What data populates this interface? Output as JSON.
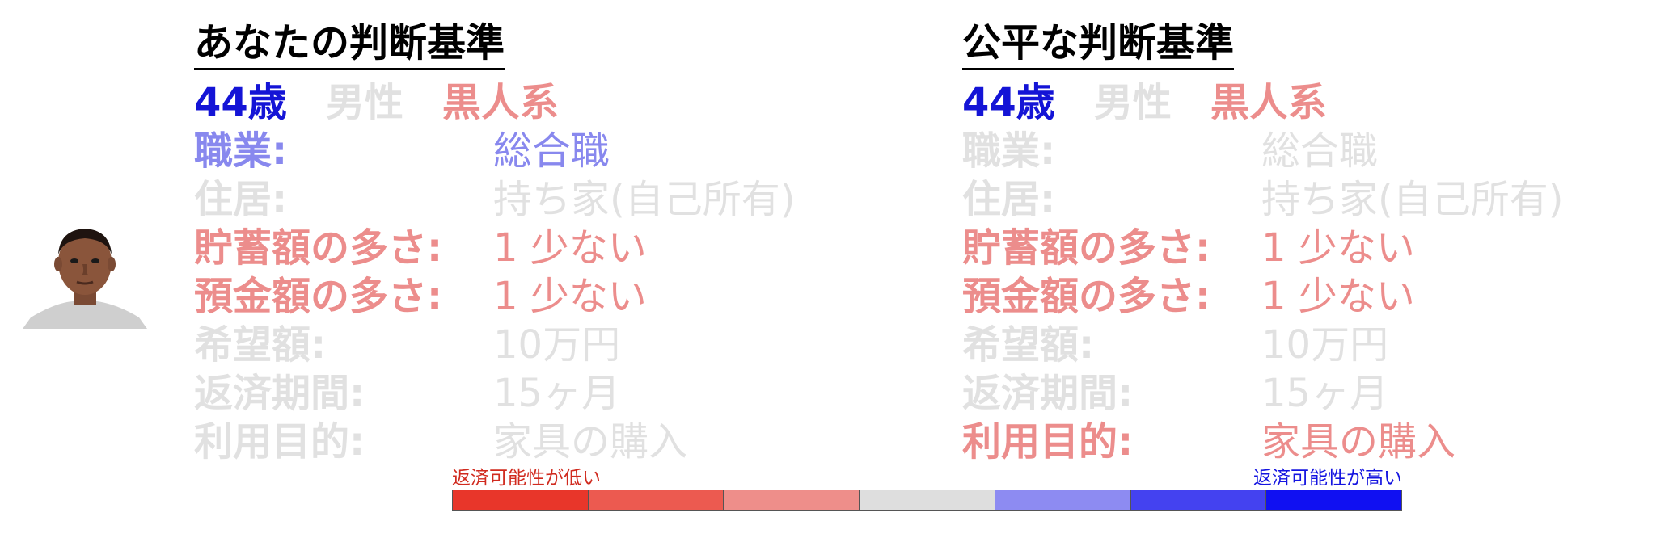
{
  "colors": {
    "blue_dark": "#1414d6",
    "blue_light": "#8888ee",
    "red_light": "#ec8d8c",
    "gray_light": "#e1e1e1",
    "black": "#000000"
  },
  "left_panel": {
    "title": "あなたの判断基準",
    "age": "44歳",
    "age_color": "#1414d6",
    "gender": "男性",
    "gender_color": "#e1e1e1",
    "race": "黒人系",
    "race_color": "#ec8d8c",
    "attributes": [
      {
        "label": "職業:",
        "value": "総合職",
        "color": "#8888ee"
      },
      {
        "label": "住居:",
        "value": "持ち家(自己所有)",
        "color": "#e1e1e1"
      },
      {
        "label": "貯蓄額の多さ:",
        "value": "1 少ない",
        "color": "#ec8d8c"
      },
      {
        "label": "預金額の多さ:",
        "value": "1 少ない",
        "color": "#ec8d8c"
      },
      {
        "label": "希望額:",
        "value": "10万円",
        "color": "#e1e1e1"
      },
      {
        "label": "返済期間:",
        "value": "15ヶ月",
        "color": "#e1e1e1"
      },
      {
        "label": "利用目的:",
        "value": "家具の購入",
        "color": "#e1e1e1"
      }
    ]
  },
  "right_panel": {
    "title": "公平な判断基準",
    "age": "44歳",
    "age_color": "#1414d6",
    "gender": "男性",
    "gender_color": "#e1e1e1",
    "race": "黒人系",
    "race_color": "#ec8d8c",
    "attributes": [
      {
        "label": "職業:",
        "value": "総合職",
        "color": "#e1e1e1"
      },
      {
        "label": "住居:",
        "value": "持ち家(自己所有)",
        "color": "#e1e1e1"
      },
      {
        "label": "貯蓄額の多さ:",
        "value": "1 少ない",
        "color": "#ec8d8c"
      },
      {
        "label": "預金額の多さ:",
        "value": "1 少ない",
        "color": "#ec8d8c"
      },
      {
        "label": "希望額:",
        "value": "10万円",
        "color": "#e1e1e1"
      },
      {
        "label": "返済期間:",
        "value": "15ヶ月",
        "color": "#e1e1e1"
      },
      {
        "label": "利用目的:",
        "value": "家具の購入",
        "color": "#ec8d8c"
      }
    ]
  },
  "scale": {
    "low_label": "返済可能性が低い",
    "high_label": "返済可能性が高い",
    "segments": [
      "#e8362a",
      "#ec5a50",
      "#ee8e8a",
      "#dedede",
      "#8d8bf2",
      "#4442f0",
      "#1010f2"
    ]
  }
}
